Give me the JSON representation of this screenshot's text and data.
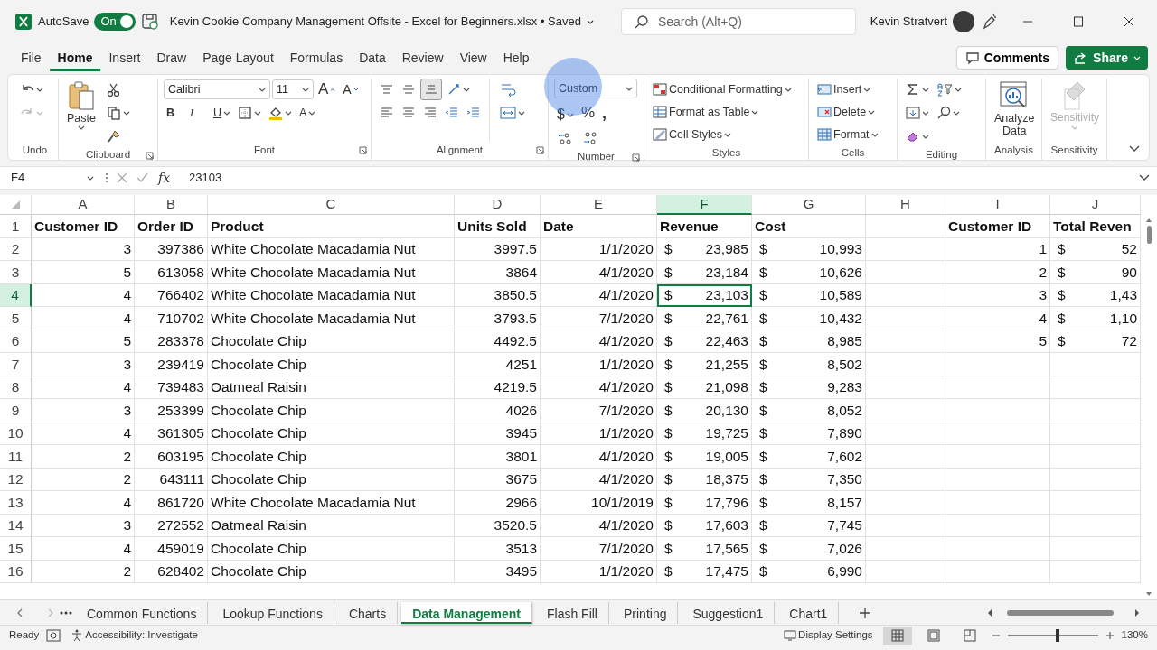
{
  "title_bar": {
    "autosave_label": "AutoSave",
    "autosave_on": true,
    "autosave_state": "On",
    "document_title": "Kevin Cookie Company Management Offsite - Excel for Beginners.xlsx • Saved",
    "search_placeholder": "Search (Alt+Q)",
    "user_name": "Kevin Stratvert"
  },
  "menu_tabs": [
    {
      "label": "File",
      "selected": false
    },
    {
      "label": "Home",
      "selected": true
    },
    {
      "label": "Insert",
      "selected": false
    },
    {
      "label": "Draw",
      "selected": false
    },
    {
      "label": "Page Layout",
      "selected": false
    },
    {
      "label": "Formulas",
      "selected": false
    },
    {
      "label": "Data",
      "selected": false
    },
    {
      "label": "Review",
      "selected": false
    },
    {
      "label": "View",
      "selected": false
    },
    {
      "label": "Help",
      "selected": false
    }
  ],
  "comments_button": "Comments",
  "share_button": "Share",
  "ribbon": [
    {
      "kind": "undo",
      "label": "Undo",
      "redo_disabled": true
    },
    {
      "kind": "clipboard",
      "label": "Clipboard",
      "paste": "Paste",
      "launcher": true
    },
    {
      "kind": "font",
      "label": "Font",
      "font": "Calibri",
      "size": "11",
      "grow": "A",
      "shrink": "A",
      "bold": "B",
      "italic": "I",
      "underline": "U",
      "color_letter": "A",
      "launcher": true
    },
    {
      "kind": "alignment",
      "label": "Alignment",
      "bottom_align_selected": true,
      "launcher": true
    },
    {
      "kind": "number",
      "label": "Number",
      "format": "Custom",
      "currency": "$",
      "percent": "%",
      "comma": ",",
      "launcher": true
    },
    {
      "kind": "styles",
      "label": "Styles",
      "items": [
        "Conditional Formatting",
        "Format as Table",
        "Cell Styles"
      ]
    },
    {
      "kind": "cells",
      "label": "Cells",
      "items": [
        "Insert",
        "Delete",
        "Format"
      ]
    },
    {
      "kind": "editing",
      "label": "Editing"
    },
    {
      "kind": "analysis",
      "label": "Analysis",
      "button": "Analyze Data"
    },
    {
      "kind": "sensitivity",
      "label": "Sensitivity",
      "button": "Sensitivity",
      "disabled": true
    }
  ],
  "formula_bar": {
    "name_box": "F4",
    "function_label": "fx",
    "formula": "23103"
  },
  "sheet": {
    "columns": [
      {
        "label": "A",
        "selected": false
      },
      {
        "label": "B",
        "selected": false
      },
      {
        "label": "C",
        "selected": false
      },
      {
        "label": "D",
        "selected": false
      },
      {
        "label": "E",
        "selected": false
      },
      {
        "label": "F",
        "selected": true
      },
      {
        "label": "G",
        "selected": false
      },
      {
        "label": "H",
        "selected": false
      },
      {
        "label": "I",
        "selected": false
      },
      {
        "label": "J",
        "selected": false
      }
    ],
    "rows": [
      {
        "number": "1",
        "selected": false,
        "kind": "header",
        "cells": {
          "A": "Customer ID",
          "B": "Order ID",
          "C": "Product",
          "D": "Units Sold",
          "E": "Date",
          "F": "Revenue",
          "G": "Cost",
          "I": "Customer ID",
          "J": "Total Reven"
        }
      },
      {
        "number": "2",
        "selected": false,
        "kind": "data",
        "cells": {
          "A": "3",
          "B": "397386",
          "C": "White Chocolate Macadamia Nut",
          "D": "3997.5",
          "E": "1/1/2020",
          "F": {
            "symbol": "$",
            "amount": "23,985"
          },
          "G": {
            "symbol": "$",
            "amount": "10,993"
          },
          "I": "1",
          "J": {
            "symbol": "$",
            "amount": "52"
          }
        }
      },
      {
        "number": "3",
        "selected": false,
        "kind": "data",
        "cells": {
          "A": "5",
          "B": "613058",
          "C": "White Chocolate Macadamia Nut",
          "D": "3864",
          "E": "4/1/2020",
          "F": {
            "symbol": "$",
            "amount": "23,184"
          },
          "G": {
            "symbol": "$",
            "amount": "10,626"
          },
          "I": "2",
          "J": {
            "symbol": "$",
            "amount": "90"
          }
        }
      },
      {
        "number": "4",
        "selected": true,
        "kind": "data",
        "cells": {
          "A": "4",
          "B": "766402",
          "C": "White Chocolate Macadamia Nut",
          "D": "3850.5",
          "E": "4/1/2020",
          "F": {
            "symbol": "$",
            "amount": "23,103"
          },
          "G": {
            "symbol": "$",
            "amount": "10,589"
          },
          "I": "3",
          "J": {
            "symbol": "$",
            "amount": "1,43"
          }
        }
      },
      {
        "number": "5",
        "selected": false,
        "kind": "data",
        "cells": {
          "A": "4",
          "B": "710702",
          "C": "White Chocolate Macadamia Nut",
          "D": "3793.5",
          "E": "7/1/2020",
          "F": {
            "symbol": "$",
            "amount": "22,761"
          },
          "G": {
            "symbol": "$",
            "amount": "10,432"
          },
          "I": "4",
          "J": {
            "symbol": "$",
            "amount": "1,10"
          }
        }
      },
      {
        "number": "6",
        "selected": false,
        "kind": "data",
        "cells": {
          "A": "5",
          "B": "283378",
          "C": "Chocolate Chip",
          "D": "4492.5",
          "E": "4/1/2020",
          "F": {
            "symbol": "$",
            "amount": "22,463"
          },
          "G": {
            "symbol": "$",
            "amount": "8,985"
          },
          "I": "5",
          "J": {
            "symbol": "$",
            "amount": "72"
          }
        }
      },
      {
        "number": "7",
        "selected": false,
        "kind": "data",
        "cells": {
          "A": "3",
          "B": "239419",
          "C": "Chocolate Chip",
          "D": "4251",
          "E": "1/1/2020",
          "F": {
            "symbol": "$",
            "amount": "21,255"
          },
          "G": {
            "symbol": "$",
            "amount": "8,502"
          }
        }
      },
      {
        "number": "8",
        "selected": false,
        "kind": "data",
        "cells": {
          "A": "4",
          "B": "739483",
          "C": "Oatmeal Raisin",
          "D": "4219.5",
          "E": "4/1/2020",
          "F": {
            "symbol": "$",
            "amount": "21,098"
          },
          "G": {
            "symbol": "$",
            "amount": "9,283"
          }
        }
      },
      {
        "number": "9",
        "selected": false,
        "kind": "data",
        "cells": {
          "A": "3",
          "B": "253399",
          "C": "Chocolate Chip",
          "D": "4026",
          "E": "7/1/2020",
          "F": {
            "symbol": "$",
            "amount": "20,130"
          },
          "G": {
            "symbol": "$",
            "amount": "8,052"
          }
        }
      },
      {
        "number": "10",
        "selected": false,
        "kind": "data",
        "cells": {
          "A": "4",
          "B": "361305",
          "C": "Chocolate Chip",
          "D": "3945",
          "E": "1/1/2020",
          "F": {
            "symbol": "$",
            "amount": "19,725"
          },
          "G": {
            "symbol": "$",
            "amount": "7,890"
          }
        }
      },
      {
        "number": "11",
        "selected": false,
        "kind": "data",
        "cells": {
          "A": "2",
          "B": "603195",
          "C": "Chocolate Chip",
          "D": "3801",
          "E": "4/1/2020",
          "F": {
            "symbol": "$",
            "amount": "19,005"
          },
          "G": {
            "symbol": "$",
            "amount": "7,602"
          }
        }
      },
      {
        "number": "12",
        "selected": false,
        "kind": "data",
        "cells": {
          "A": "2",
          "B": "643111",
          "C": "Chocolate Chip",
          "D": "3675",
          "E": "4/1/2020",
          "F": {
            "symbol": "$",
            "amount": "18,375"
          },
          "G": {
            "symbol": "$",
            "amount": "7,350"
          }
        }
      },
      {
        "number": "13",
        "selected": false,
        "kind": "data",
        "cells": {
          "A": "4",
          "B": "861720",
          "C": "White Chocolate Macadamia Nut",
          "D": "2966",
          "E": "10/1/2019",
          "F": {
            "symbol": "$",
            "amount": "17,796"
          },
          "G": {
            "symbol": "$",
            "amount": "8,157"
          }
        }
      },
      {
        "number": "14",
        "selected": false,
        "kind": "data",
        "cells": {
          "A": "3",
          "B": "272552",
          "C": "Oatmeal Raisin",
          "D": "3520.5",
          "E": "4/1/2020",
          "F": {
            "symbol": "$",
            "amount": "17,603"
          },
          "G": {
            "symbol": "$",
            "amount": "7,745"
          }
        }
      },
      {
        "number": "15",
        "selected": false,
        "kind": "data",
        "cells": {
          "A": "4",
          "B": "459019",
          "C": "Chocolate Chip",
          "D": "3513",
          "E": "7/1/2020",
          "F": {
            "symbol": "$",
            "amount": "17,565"
          },
          "G": {
            "symbol": "$",
            "amount": "7,026"
          }
        }
      },
      {
        "number": "16",
        "selected": false,
        "kind": "data",
        "cells": {
          "A": "2",
          "B": "628402",
          "C": "Chocolate Chip",
          "D": "3495",
          "E": "1/1/2020",
          "F": {
            "symbol": "$",
            "amount": "17,475"
          },
          "G": {
            "symbol": "$",
            "amount": "6,990"
          }
        }
      }
    ]
  },
  "sheet_tabs": [
    {
      "label": "Common Functions",
      "selected": false
    },
    {
      "label": "Lookup Functions",
      "selected": false
    },
    {
      "label": "Charts",
      "selected": false
    },
    {
      "label": "Data Management",
      "selected": true
    },
    {
      "label": "Flash Fill",
      "selected": false
    },
    {
      "label": "Printing",
      "selected": false
    },
    {
      "label": "Suggestion1",
      "selected": false
    },
    {
      "label": "Chart1",
      "selected": false
    }
  ],
  "status_bar": {
    "status": "Ready",
    "accessibility": "Accessibility: Investigate",
    "display_settings": "Display Settings",
    "views": [
      {
        "kind": "normal",
        "selected": true
      },
      {
        "kind": "page_layout",
        "selected": false
      },
      {
        "kind": "page_break",
        "selected": false
      }
    ],
    "zoom": {
      "level": 0.55,
      "reading": "130%"
    }
  }
}
